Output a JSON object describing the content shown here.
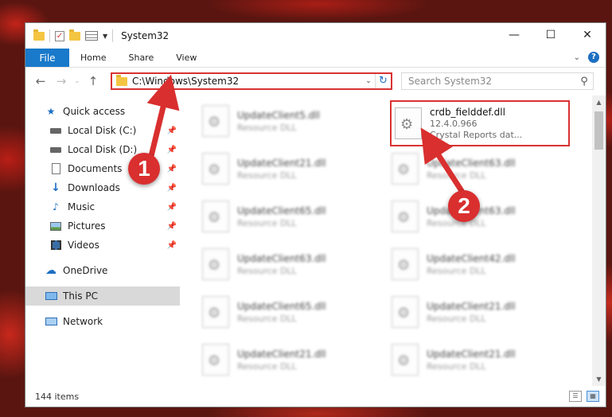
{
  "window": {
    "title": "System32",
    "controls": {
      "minimize": "—",
      "maximize": "☐",
      "close": "✕"
    }
  },
  "ribbon": {
    "file": "File",
    "tabs": [
      "Home",
      "Share",
      "View"
    ]
  },
  "address": {
    "path": "C:\\Windows\\System32",
    "search_placeholder": "Search System32"
  },
  "sidebar": {
    "quick_access": "Quick access",
    "items": [
      {
        "label": "Local Disk (C:)",
        "icon": "drive-icon"
      },
      {
        "label": "Local Disk (D:)",
        "icon": "drive-icon"
      },
      {
        "label": "Documents",
        "icon": "documents-icon"
      },
      {
        "label": "Downloads",
        "icon": "downloads-icon"
      },
      {
        "label": "Music",
        "icon": "music-icon"
      },
      {
        "label": "Pictures",
        "icon": "pictures-icon"
      },
      {
        "label": "Videos",
        "icon": "videos-icon"
      }
    ],
    "onedrive": "OneDrive",
    "this_pc": "This PC",
    "network": "Network"
  },
  "files": {
    "highlighted": {
      "name": "crdb_fielddef.dll",
      "version": "12.4.0.966",
      "description": "Crystal Reports dat..."
    },
    "left_column": [
      {
        "name": "UpdateClient5.dll",
        "type": "Resource DLL"
      },
      {
        "name": "UpdateClient21.dll",
        "type": "Resource DLL"
      },
      {
        "name": "UpdateClient65.dll",
        "type": "Resource DLL"
      },
      {
        "name": "UpdateClient63.dll",
        "type": "Resource DLL"
      },
      {
        "name": "UpdateClient65.dll",
        "type": "Resource DLL"
      },
      {
        "name": "UpdateClient21.dll",
        "type": "Resource DLL"
      }
    ],
    "right_column": [
      {
        "name": "UpdateClient63.dll",
        "type": "Resource DLL"
      },
      {
        "name": "UpdateClient63.dll",
        "type": "Resource DLL"
      },
      {
        "name": "UpdateClient42.dll",
        "type": "Resource DLL"
      },
      {
        "name": "UpdateClient21.dll",
        "type": "Resource DLL"
      },
      {
        "name": "UpdateClient21.dll",
        "type": "Resource DLL"
      }
    ]
  },
  "status": {
    "items": "144 items"
  },
  "callouts": {
    "one": "1",
    "two": "2"
  },
  "colors": {
    "accent": "#1979ca",
    "highlight": "#d93232",
    "callout": "#d92f2f"
  }
}
